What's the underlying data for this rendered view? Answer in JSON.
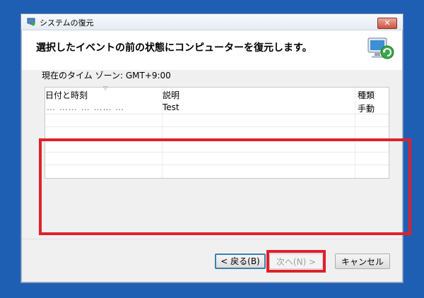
{
  "window": {
    "title": "システムの復元",
    "close_glyph": "✕"
  },
  "header": {
    "instruction": "選択したイベントの前の状態にコンピューターを復元します。",
    "icon": "system-restore-computer-icon"
  },
  "timezone": {
    "label": "現在のタイム ゾーン: GMT+9:00"
  },
  "restore_points": {
    "columns": [
      "日付と時刻",
      "説明",
      "種類"
    ],
    "rows": [
      {
        "date": "… …… … …… …",
        "description": "Test",
        "type": "手動"
      }
    ]
  },
  "buttons": {
    "back": "< 戻る(B)",
    "next": "次へ(N) >",
    "cancel": "キャンセル"
  },
  "colors": {
    "desktop": "#1f5fb3",
    "highlight_box": "#e0202a",
    "dialog_bg": "#f0f0f0"
  }
}
